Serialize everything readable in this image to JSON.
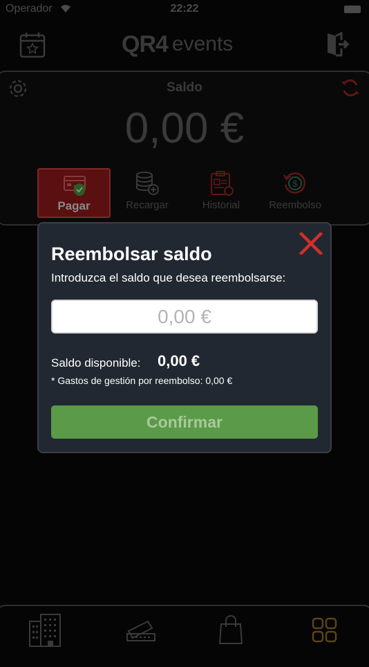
{
  "status_bar": {
    "carrier": "Operador",
    "time": "22:22"
  },
  "header": {
    "logo_main": "QR4",
    "logo_sub": "events"
  },
  "balance": {
    "label": "Saldo",
    "amount": "0,00 €"
  },
  "tabs": [
    {
      "label": "Pagar",
      "icon": "pay-card-icon",
      "active": true
    },
    {
      "label": "Recargar",
      "icon": "coins-add-icon",
      "active": false
    },
    {
      "label": "Historial",
      "icon": "history-icon",
      "active": false
    },
    {
      "label": "Reembolso",
      "icon": "refund-icon",
      "active": false
    }
  ],
  "modal": {
    "title": "Reembolsar saldo",
    "subtitle": "Introduzca el saldo que desea reembolsarse:",
    "input_placeholder": "0,00 €",
    "available_label": "Saldo disponible:",
    "available_value": "0,00 €",
    "fee_note": "* Gastos de gestión por reembolso: 0,00 €",
    "confirm_label": "Confirmar"
  },
  "bottom_nav": [
    "buildings-icon",
    "ticket-icon",
    "shopping-bag-icon",
    "grid-icon"
  ],
  "colors": {
    "accent_red": "#d0302b",
    "confirm_green": "#5a9a48",
    "modal_bg": "#222831"
  }
}
